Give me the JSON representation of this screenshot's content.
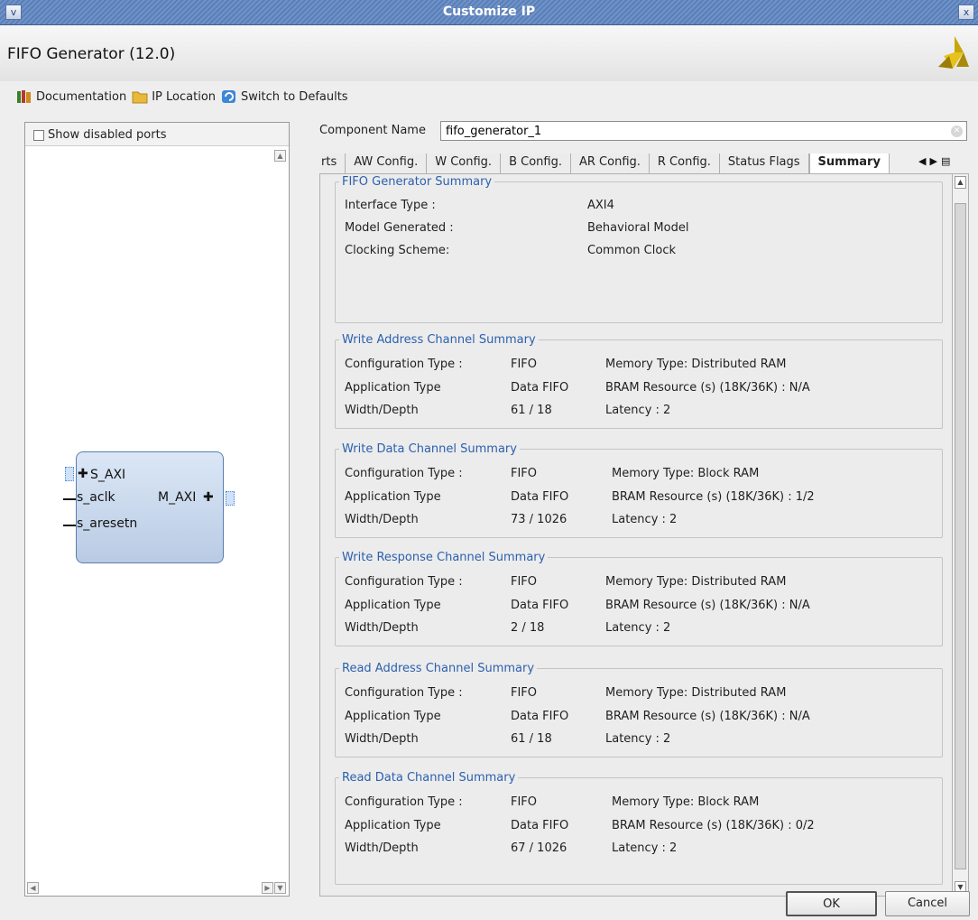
{
  "window": {
    "title": "Customize IP",
    "min_label": "v",
    "close_label": "x"
  },
  "header": {
    "ip_name": "FIFO Generator (12.0)"
  },
  "toolbar": {
    "documentation": "Documentation",
    "ip_location": "IP Location",
    "switch_defaults": "Switch to Defaults"
  },
  "left": {
    "show_disabled_ports": "Show disabled ports",
    "block": {
      "port_saxi": "S_AXI",
      "port_aclk": "s_aclk",
      "port_aresetn": "s_aresetn",
      "port_maxi": "M_AXI"
    }
  },
  "component": {
    "label": "Component Name",
    "value": "fifo_generator_1"
  },
  "tabs": [
    {
      "label": "rts"
    },
    {
      "label": "AW Config."
    },
    {
      "label": "W Config."
    },
    {
      "label": "B Config."
    },
    {
      "label": "AR Config."
    },
    {
      "label": "R Config."
    },
    {
      "label": "Status Flags"
    },
    {
      "label": "Summary"
    }
  ],
  "summary": {
    "title": "FIFO Generator Summary",
    "interface_label": "Interface Type :",
    "interface_value": "AXI4",
    "model_label": "Model Generated :",
    "model_value": "Behavioral Model",
    "clock_label": "Clocking Scheme:",
    "clock_value": "Common Clock"
  },
  "labels": {
    "config_type": "Configuration Type :",
    "app_type": "Application Type",
    "width_depth": "Width/Depth"
  },
  "channels": [
    {
      "title": "Write Address Channel Summary",
      "config": "FIFO",
      "app": "Data FIFO",
      "wd": "61 / 18",
      "mem": "Memory Type: Distributed RAM",
      "bram": "BRAM Resource (s) (18K/36K) : N/A",
      "lat": "Latency : 2"
    },
    {
      "title": "Write Data Channel Summary",
      "config": "FIFO",
      "app": "Data FIFO",
      "wd": "73 / 1026",
      "mem": "Memory Type: Block RAM",
      "bram": "BRAM Resource (s) (18K/36K) : 1/2",
      "lat": "Latency : 2"
    },
    {
      "title": "Write Response Channel Summary",
      "config": "FIFO",
      "app": "Data FIFO",
      "wd": "2 / 18",
      "mem": "Memory Type: Distributed RAM",
      "bram": "BRAM Resource (s) (18K/36K) : N/A",
      "lat": "Latency : 2"
    },
    {
      "title": "Read Address Channel Summary",
      "config": "FIFO",
      "app": "Data FIFO",
      "wd": "61 / 18",
      "mem": "Memory Type: Distributed RAM",
      "bram": "BRAM Resource (s) (18K/36K) : N/A",
      "lat": "Latency : 2"
    },
    {
      "title": "Read Data Channel Summary",
      "config": "FIFO",
      "app": "Data FIFO",
      "wd": "67 / 1026",
      "mem": "Memory Type: Block RAM",
      "bram": "BRAM Resource (s) (18K/36K) : 0/2",
      "lat": "Latency : 2"
    }
  ],
  "buttons": {
    "ok": "OK",
    "cancel": "Cancel"
  },
  "colors": {
    "title_bar": "#5a7fb8",
    "legend": "#2c60ae",
    "block_fill": "#b9cbe4"
  }
}
